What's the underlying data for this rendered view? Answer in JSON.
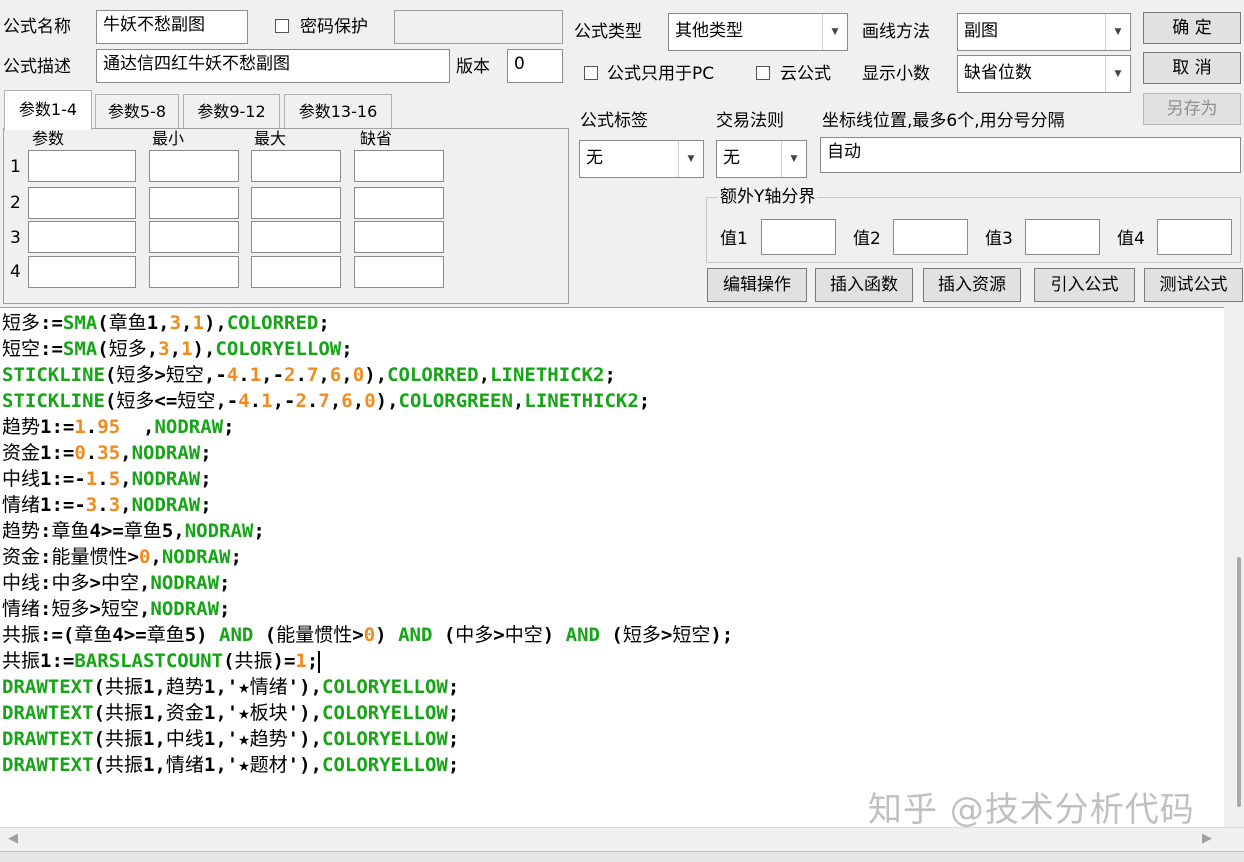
{
  "header": {
    "name_label": "公式名称",
    "name_value": "牛妖不愁副图",
    "password_label": "密码保护",
    "password_value": "",
    "desc_label": "公式描述",
    "desc_value": "通达信四红牛妖不愁副图",
    "version_label": "版本",
    "version_value": "0",
    "type_label": "公式类型",
    "type_value": "其他类型",
    "draw_label": "画线方法",
    "draw_value": "副图",
    "pc_only_label": "公式只用于PC",
    "cloud_label": "云公式",
    "decimal_label": "显示小数",
    "decimal_value": "缺省位数"
  },
  "buttons": {
    "ok": "确  定",
    "cancel": "取  消",
    "save_as": "另存为",
    "edit_op": "编辑操作",
    "insert_func": "插入函数",
    "insert_res": "插入资源",
    "import_formula": "引入公式",
    "test_formula": "测试公式"
  },
  "tabs": [
    "参数1-4",
    "参数5-8",
    "参数9-12",
    "参数13-16"
  ],
  "params": {
    "headers": [
      "参数",
      "最小",
      "最大",
      "缺省"
    ],
    "rows": [
      "1",
      "2",
      "3",
      "4"
    ]
  },
  "right": {
    "tag_label": "公式标签",
    "tag_value": "无",
    "rule_label": "交易法则",
    "rule_value": "无",
    "coord_label": "坐标线位置,最多6个,用分号分隔",
    "coord_value": "自动",
    "y_group_label": "额外Y轴分界",
    "y_values": [
      "值1",
      "值2",
      "值3",
      "值4"
    ]
  },
  "code_lines": [
    [
      [
        "c",
        "短多"
      ],
      [
        "p",
        ":="
      ],
      [
        "k",
        "SMA"
      ],
      [
        "p",
        "("
      ],
      [
        "c",
        "章鱼"
      ],
      [
        "p",
        "1,"
      ],
      [
        "n",
        "3"
      ],
      [
        "p",
        ","
      ],
      [
        "n",
        "1"
      ],
      [
        "p",
        "),"
      ],
      [
        "k",
        "COLORRED"
      ],
      [
        "p",
        ";"
      ]
    ],
    [
      [
        "c",
        "短空"
      ],
      [
        "p",
        ":="
      ],
      [
        "k",
        "SMA"
      ],
      [
        "p",
        "("
      ],
      [
        "c",
        "短多"
      ],
      [
        "p",
        ","
      ],
      [
        "n",
        "3"
      ],
      [
        "p",
        ","
      ],
      [
        "n",
        "1"
      ],
      [
        "p",
        "),"
      ],
      [
        "k",
        "COLORYELLOW"
      ],
      [
        "p",
        ";"
      ]
    ],
    [
      [
        "k",
        "STICKLINE"
      ],
      [
        "p",
        "("
      ],
      [
        "c",
        "短多"
      ],
      [
        "p",
        ">"
      ],
      [
        "c",
        "短空"
      ],
      [
        "p",
        ",-"
      ],
      [
        "n",
        "4"
      ],
      [
        "p",
        "."
      ],
      [
        "n",
        "1"
      ],
      [
        "p",
        ",-"
      ],
      [
        "n",
        "2"
      ],
      [
        "p",
        "."
      ],
      [
        "n",
        "7"
      ],
      [
        "p",
        ","
      ],
      [
        "n",
        "6"
      ],
      [
        "p",
        ","
      ],
      [
        "n",
        "0"
      ],
      [
        "p",
        "),"
      ],
      [
        "k",
        "COLORRED"
      ],
      [
        "p",
        ","
      ],
      [
        "k",
        "LINETHICK2"
      ],
      [
        "p",
        ";"
      ]
    ],
    [
      [
        "k",
        "STICKLINE"
      ],
      [
        "p",
        "("
      ],
      [
        "c",
        "短多"
      ],
      [
        "p",
        "<="
      ],
      [
        "c",
        "短空"
      ],
      [
        "p",
        ",-"
      ],
      [
        "n",
        "4"
      ],
      [
        "p",
        "."
      ],
      [
        "n",
        "1"
      ],
      [
        "p",
        ",-"
      ],
      [
        "n",
        "2"
      ],
      [
        "p",
        "."
      ],
      [
        "n",
        "7"
      ],
      [
        "p",
        ","
      ],
      [
        "n",
        "6"
      ],
      [
        "p",
        ","
      ],
      [
        "n",
        "0"
      ],
      [
        "p",
        "),"
      ],
      [
        "k",
        "COLORGREEN"
      ],
      [
        "p",
        ","
      ],
      [
        "k",
        "LINETHICK2"
      ],
      [
        "p",
        ";"
      ]
    ],
    [
      [
        "c",
        "趋势"
      ],
      [
        "p",
        "1:="
      ],
      [
        "n",
        "1"
      ],
      [
        "p",
        "."
      ],
      [
        "n",
        "95"
      ],
      [
        "p",
        "  ,"
      ],
      [
        "k",
        "NODRAW"
      ],
      [
        "p",
        ";"
      ]
    ],
    [
      [
        "c",
        "资金"
      ],
      [
        "p",
        "1:="
      ],
      [
        "n",
        "0"
      ],
      [
        "p",
        "."
      ],
      [
        "n",
        "35"
      ],
      [
        "p",
        ","
      ],
      [
        "k",
        "NODRAW"
      ],
      [
        "p",
        ";"
      ]
    ],
    [
      [
        "c",
        "中线"
      ],
      [
        "p",
        "1:=-"
      ],
      [
        "n",
        "1"
      ],
      [
        "p",
        "."
      ],
      [
        "n",
        "5"
      ],
      [
        "p",
        ","
      ],
      [
        "k",
        "NODRAW"
      ],
      [
        "p",
        ";"
      ]
    ],
    [
      [
        "c",
        "情绪"
      ],
      [
        "p",
        "1:=-"
      ],
      [
        "n",
        "3"
      ],
      [
        "p",
        "."
      ],
      [
        "n",
        "3"
      ],
      [
        "p",
        ","
      ],
      [
        "k",
        "NODRAW"
      ],
      [
        "p",
        ";"
      ]
    ],
    [
      [
        "c",
        "趋势"
      ],
      [
        "p",
        ":"
      ],
      [
        "c",
        "章鱼"
      ],
      [
        "p",
        "4>="
      ],
      [
        "c",
        "章鱼"
      ],
      [
        "p",
        "5,"
      ],
      [
        "k",
        "NODRAW"
      ],
      [
        "p",
        ";"
      ]
    ],
    [
      [
        "c",
        "资金"
      ],
      [
        "p",
        ":"
      ],
      [
        "c",
        "能量惯性"
      ],
      [
        "p",
        ">"
      ],
      [
        "n",
        "0"
      ],
      [
        "p",
        ","
      ],
      [
        "k",
        "NODRAW"
      ],
      [
        "p",
        ";"
      ]
    ],
    [
      [
        "c",
        "中线"
      ],
      [
        "p",
        ":"
      ],
      [
        "c",
        "中多"
      ],
      [
        "p",
        ">"
      ],
      [
        "c",
        "中空"
      ],
      [
        "p",
        ","
      ],
      [
        "k",
        "NODRAW"
      ],
      [
        "p",
        ";"
      ]
    ],
    [
      [
        "c",
        "情绪"
      ],
      [
        "p",
        ":"
      ],
      [
        "c",
        "短多"
      ],
      [
        "p",
        ">"
      ],
      [
        "c",
        "短空"
      ],
      [
        "p",
        ","
      ],
      [
        "k",
        "NODRAW"
      ],
      [
        "p",
        ";"
      ]
    ],
    [
      [
        "c",
        "共振"
      ],
      [
        "p",
        ":=("
      ],
      [
        "c",
        "章鱼"
      ],
      [
        "p",
        "4>="
      ],
      [
        "c",
        "章鱼"
      ],
      [
        "p",
        "5) "
      ],
      [
        "k",
        "AND"
      ],
      [
        "p",
        " ("
      ],
      [
        "c",
        "能量惯性"
      ],
      [
        "p",
        ">"
      ],
      [
        "n",
        "0"
      ],
      [
        "p",
        ") "
      ],
      [
        "k",
        "AND"
      ],
      [
        "p",
        " ("
      ],
      [
        "c",
        "中多"
      ],
      [
        "p",
        ">"
      ],
      [
        "c",
        "中空"
      ],
      [
        "p",
        ") "
      ],
      [
        "k",
        "AND"
      ],
      [
        "p",
        " ("
      ],
      [
        "c",
        "短多"
      ],
      [
        "p",
        ">"
      ],
      [
        "c",
        "短空"
      ],
      [
        "p",
        ");"
      ]
    ],
    [
      [
        "c",
        "共振"
      ],
      [
        "p",
        "1:="
      ],
      [
        "k",
        "BARSLASTCOUNT"
      ],
      [
        "p",
        "("
      ],
      [
        "c",
        "共振"
      ],
      [
        "p",
        ")="
      ],
      [
        "n",
        "1"
      ],
      [
        "p",
        ";"
      ]
    ],
    [
      [
        "k",
        "DRAWTEXT"
      ],
      [
        "p",
        "("
      ],
      [
        "c",
        "共振"
      ],
      [
        "p",
        "1,"
      ],
      [
        "c",
        "趋势"
      ],
      [
        "p",
        "1,'"
      ],
      [
        "c",
        "★情绪"
      ],
      [
        "p",
        "'),"
      ],
      [
        "k",
        "COLORYELLOW"
      ],
      [
        "p",
        ";"
      ]
    ],
    [
      [
        "k",
        "DRAWTEXT"
      ],
      [
        "p",
        "("
      ],
      [
        "c",
        "共振"
      ],
      [
        "p",
        "1,"
      ],
      [
        "c",
        "资金"
      ],
      [
        "p",
        "1,'"
      ],
      [
        "c",
        "★板块"
      ],
      [
        "p",
        "'),"
      ],
      [
        "k",
        "COLORYELLOW"
      ],
      [
        "p",
        ";"
      ]
    ],
    [
      [
        "k",
        "DRAWTEXT"
      ],
      [
        "p",
        "("
      ],
      [
        "c",
        "共振"
      ],
      [
        "p",
        "1,"
      ],
      [
        "c",
        "中线"
      ],
      [
        "p",
        "1,'"
      ],
      [
        "c",
        "★趋势"
      ],
      [
        "p",
        "'),"
      ],
      [
        "k",
        "COLORYELLOW"
      ],
      [
        "p",
        ";"
      ]
    ],
    [
      [
        "k",
        "DRAWTEXT"
      ],
      [
        "p",
        "("
      ],
      [
        "c",
        "共振"
      ],
      [
        "p",
        "1,"
      ],
      [
        "c",
        "情绪"
      ],
      [
        "p",
        "1,'"
      ],
      [
        "c",
        "★题材"
      ],
      [
        "p",
        "'),"
      ],
      [
        "k",
        "COLORYELLOW"
      ],
      [
        "p",
        ";"
      ]
    ]
  ],
  "colors": {
    "keyword": "#16a516",
    "number": "#f28a1c"
  },
  "watermark": "知乎 @技术分析代码"
}
